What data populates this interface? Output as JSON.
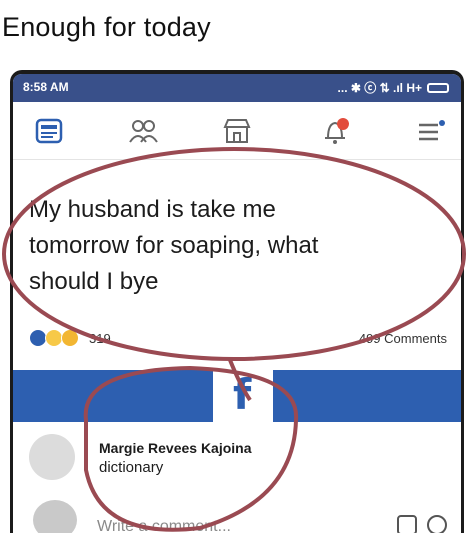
{
  "caption": "Enough for today",
  "status_bar": {
    "time": "8:58 AM",
    "indicators": "... ✱ ⓒ ⇅ .ıl H+"
  },
  "nav": {
    "items": [
      {
        "icon": "news-feed-icon"
      },
      {
        "icon": "friends-icon"
      },
      {
        "icon": "marketplace-icon"
      },
      {
        "icon": "notifications-icon"
      },
      {
        "icon": "menu-icon"
      }
    ]
  },
  "post": {
    "text_lines": [
      "My husband is take me",
      "tomorrow for soaping, what",
      "should I bye"
    ],
    "reaction_count": "319",
    "comments_count": "499 Comments"
  },
  "comment": {
    "author": "Margie Revees Kajoina",
    "text": "dictionary"
  },
  "composer": {
    "placeholder": "Write a comment..."
  },
  "colors": {
    "status_bar": "#39508a",
    "banner": "#2d5fb0",
    "annotation": "#9a4a52"
  }
}
